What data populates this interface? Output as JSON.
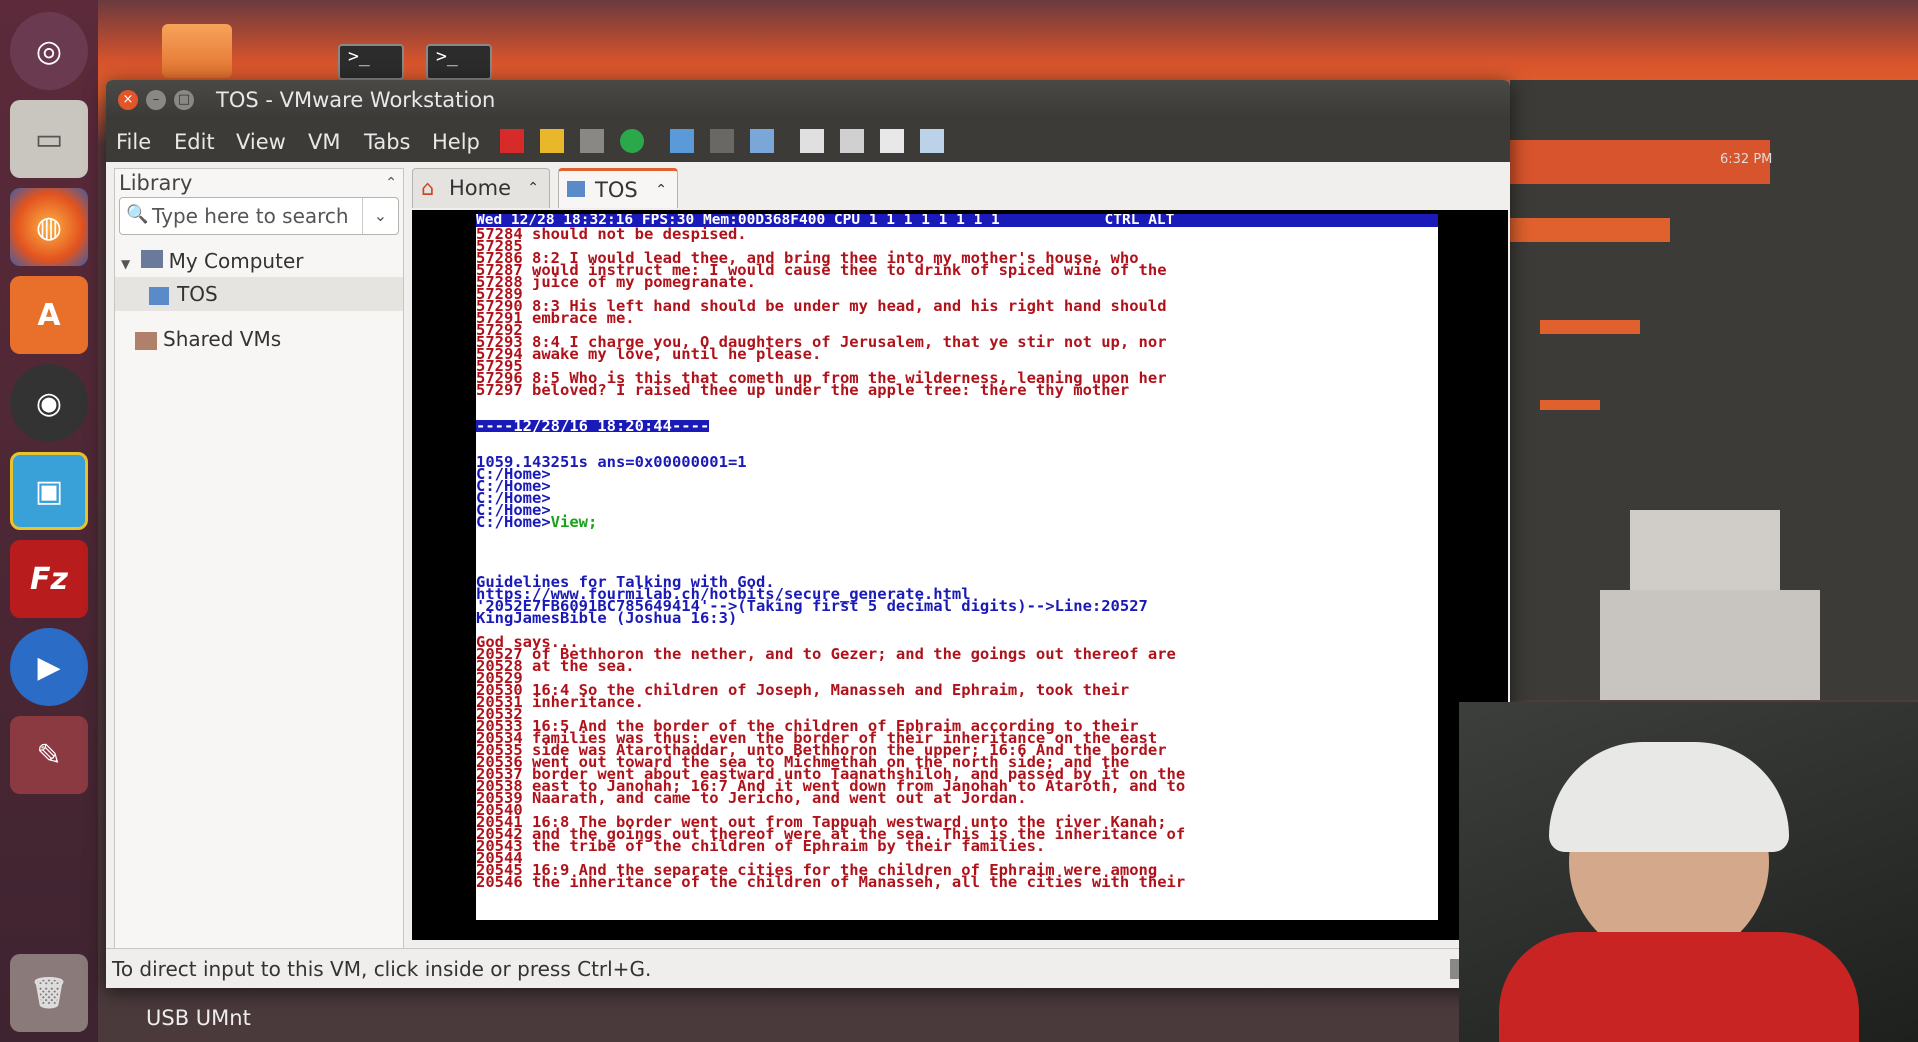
{
  "window": {
    "title": "TOS - VMware Workstation"
  },
  "menu": [
    "File",
    "Edit",
    "View",
    "VM",
    "Tabs",
    "Help"
  ],
  "library": {
    "title": "Library",
    "search_placeholder": "Type here to search",
    "items": [
      "My Computer",
      "TOS",
      "Shared VMs"
    ]
  },
  "tabs": [
    {
      "label": "Home"
    },
    {
      "label": "TOS"
    }
  ],
  "console": {
    "statusbar": "Wed 12/28 18:32:16 FPS:30 Mem:00D368F400 CPU 1 1 1 1 1 1 1 1            CTRL ALT",
    "lines": [
      "57284 should not be despised.",
      "57285",
      "57286 8:2 I would lead thee, and bring thee into my mother's house, who",
      "57287 would instruct me: I would cause thee to drink of spiced wine of the",
      "57288 juice of my pomegranate.",
      "57289",
      "57290 8:3 His left hand should be under my head, and his right hand should",
      "57291 embrace me.",
      "57292",
      "57293 8:4 I charge you, O daughters of Jerusalem, that ye stir not up, nor",
      "57294 awake my love, until he please.",
      "57295",
      "57296 8:5 Who is this that cometh up from the wilderness, leaning upon her",
      "57297 beloved? I raised thee up under the apple tree: there thy mother"
    ],
    "separator": "----12/28/16 18:20:44----",
    "ans": "1059.143251s ans=0x00000001=1",
    "prompts": [
      "C:/Home>",
      "C:/Home>",
      "C:/Home>",
      "C:/Home>"
    ],
    "cmd_prompt": "C:/Home>",
    "cmd": "View;",
    "guide": [
      "Guidelines for Talking with God.",
      "https://www.fourmilab.ch/hotbits/secure_generate.html",
      "'2052E7FB6091BC785649414'-->(Taking first 5 decimal digits)-->Line:20527",
      "KingJamesBible (Joshua 16:3)"
    ],
    "god_says": "God says...",
    "verses": [
      "20527 of Bethhoron the nether, and to Gezer; and the goings out thereof are",
      "20528 at the sea.",
      "20529",
      "20530 16:4 So the children of Joseph, Manasseh and Ephraim, took their",
      "20531 inheritance.",
      "20532",
      "20533 16:5 And the border of the children of Ephraim according to their",
      "20534 families was thus: even the border of their inheritance on the east",
      "20535 side was Atarothaddar, unto Bethhoron the upper; 16:6 And the border",
      "20536 went out toward the sea to Michmethah on the north side; and the",
      "20537 border went about eastward unto Taanathshiloh, and passed by it on the",
      "20538 east to Janohah; 16:7 And it went down from Janohah to Ataroth, and to",
      "20539 Naarath, and came to Jericho, and went out at Jordan.",
      "20540",
      "20541 16:8 The border went out from Tappuah westward unto the river Kanah;",
      "20542 and the goings out thereof were at the sea. This is the inheritance of",
      "20543 the tribe of the children of Ephraim by their families.",
      "20544",
      "20545 16:9 And the separate cities for the children of Ephraim were among",
      "20546 the inheritance of the children of Manasseh, all the cities with their"
    ]
  },
  "statusbar": "To direct input to this VM, click inside or press Ctrl+G.",
  "desktop_label": "USB UMnt",
  "panel_clock": "6:32 PM",
  "colors": {
    "accent": "#e0612e",
    "console_text": "#b0121b",
    "console_blue": "#1a1ab8"
  }
}
